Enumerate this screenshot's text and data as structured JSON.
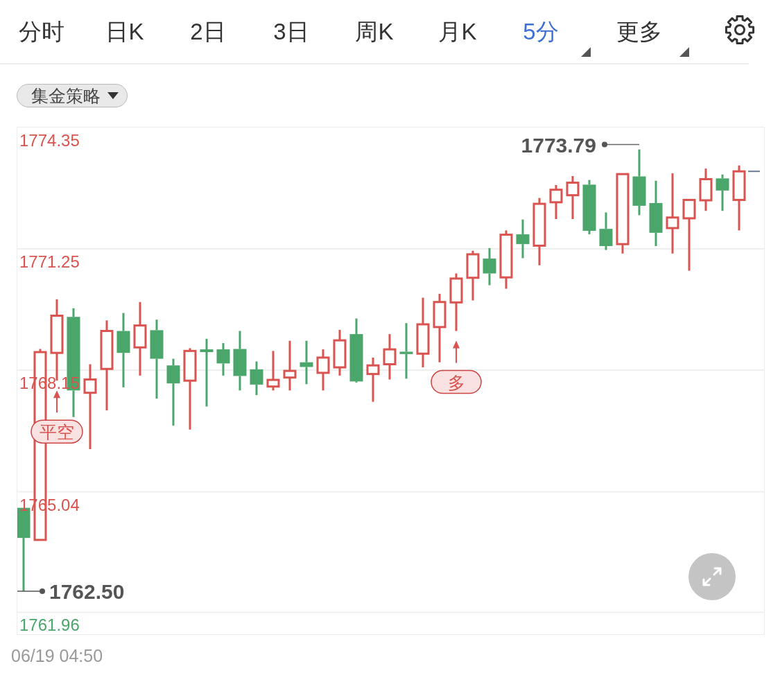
{
  "tabs": [
    {
      "label": "分时",
      "selected": false,
      "has_menu": false
    },
    {
      "label": "日K",
      "selected": false,
      "has_menu": false
    },
    {
      "label": "2日",
      "selected": false,
      "has_menu": false
    },
    {
      "label": "3日",
      "selected": false,
      "has_menu": false
    },
    {
      "label": "周K",
      "selected": false,
      "has_menu": false
    },
    {
      "label": "月K",
      "selected": false,
      "has_menu": false
    },
    {
      "label": "5分",
      "selected": true,
      "has_menu": true
    },
    {
      "label": "更多",
      "selected": false,
      "has_menu": true
    }
  ],
  "strategy_menu": {
    "label": "集金策略"
  },
  "chart": {
    "chart_data": {
      "type": "candlestick",
      "ohlc": [
        [
          1764.63,
          1764.63,
          1762.5,
          1763.86
        ],
        [
          1763.81,
          1768.69,
          1763.81,
          1768.61
        ],
        [
          1768.59,
          1769.96,
          1767.88,
          1769.54
        ],
        [
          1769.51,
          1769.73,
          1766.95,
          1767.63
        ],
        [
          1767.57,
          1768.3,
          1766.13,
          1767.91
        ],
        [
          1768.18,
          1769.42,
          1767.12,
          1769.15
        ],
        [
          1769.15,
          1769.61,
          1767.71,
          1768.59
        ],
        [
          1768.73,
          1769.89,
          1768.01,
          1769.29
        ],
        [
          1769.17,
          1769.44,
          1767.42,
          1768.44
        ],
        [
          1768.27,
          1768.44,
          1766.73,
          1767.81
        ],
        [
          1767.88,
          1768.71,
          1766.63,
          1768.64
        ],
        [
          1768.68,
          1768.95,
          1767.22,
          1768.61
        ],
        [
          1768.68,
          1768.84,
          1768.01,
          1768.32
        ],
        [
          1768.69,
          1769.15,
          1767.63,
          1768.0
        ],
        [
          1768.17,
          1768.37,
          1767.51,
          1767.78
        ],
        [
          1767.73,
          1768.64,
          1767.63,
          1767.9
        ],
        [
          1767.96,
          1768.9,
          1767.63,
          1768.13
        ],
        [
          1768.35,
          1768.9,
          1767.79,
          1768.23
        ],
        [
          1768.08,
          1768.68,
          1767.63,
          1768.47
        ],
        [
          1768.22,
          1769.18,
          1768.01,
          1768.91
        ],
        [
          1769.07,
          1769.47,
          1767.83,
          1767.86
        ],
        [
          1768.05,
          1768.47,
          1767.34,
          1768.27
        ],
        [
          1768.3,
          1769.07,
          1767.91,
          1768.68
        ],
        [
          1768.62,
          1769.35,
          1767.93,
          1768.56
        ],
        [
          1768.57,
          1770.0,
          1768.22,
          1769.32
        ],
        [
          1769.25,
          1770.1,
          1768.35,
          1769.89
        ],
        [
          1769.88,
          1770.62,
          1769.15,
          1770.49
        ],
        [
          1770.51,
          1771.2,
          1769.93,
          1771.11
        ],
        [
          1771.0,
          1771.27,
          1770.32,
          1770.62
        ],
        [
          1770.52,
          1771.72,
          1770.23,
          1771.61
        ],
        [
          1771.62,
          1772.0,
          1771.01,
          1771.37
        ],
        [
          1771.33,
          1772.55,
          1770.83,
          1772.4
        ],
        [
          1772.44,
          1772.88,
          1772.01,
          1772.76
        ],
        [
          1772.62,
          1773.11,
          1772.01,
          1772.94
        ],
        [
          1772.89,
          1773.01,
          1771.62,
          1771.71
        ],
        [
          1771.76,
          1772.18,
          1771.22,
          1771.32
        ],
        [
          1771.37,
          1773.16,
          1771.13,
          1773.16
        ],
        [
          1773.1,
          1773.79,
          1772.11,
          1772.35
        ],
        [
          1772.42,
          1772.99,
          1771.32,
          1771.66
        ],
        [
          1771.78,
          1773.18,
          1771.13,
          1772.05
        ],
        [
          1772.03,
          1772.5,
          1770.69,
          1772.5
        ],
        [
          1772.49,
          1773.3,
          1772.22,
          1773.03
        ],
        [
          1773.05,
          1773.15,
          1772.22,
          1772.74
        ],
        [
          1772.5,
          1773.38,
          1771.72,
          1773.23
        ]
      ],
      "ylim": [
        1761.4,
        1774.35
      ],
      "yticks": [
        {
          "value": 1774.35,
          "label": "1774.35"
        },
        {
          "value": 1771.25,
          "label": "1771.25"
        },
        {
          "value": 1768.15,
          "label": "1768.15"
        },
        {
          "value": 1765.04,
          "label": "1765.04"
        },
        {
          "value": 1761.96,
          "label": "1761.96"
        }
      ],
      "grid": true,
      "annotations": [
        "平空",
        "多",
        "1773.79",
        "1762.50"
      ]
    }
  },
  "time_label": "06/19 04:50"
}
